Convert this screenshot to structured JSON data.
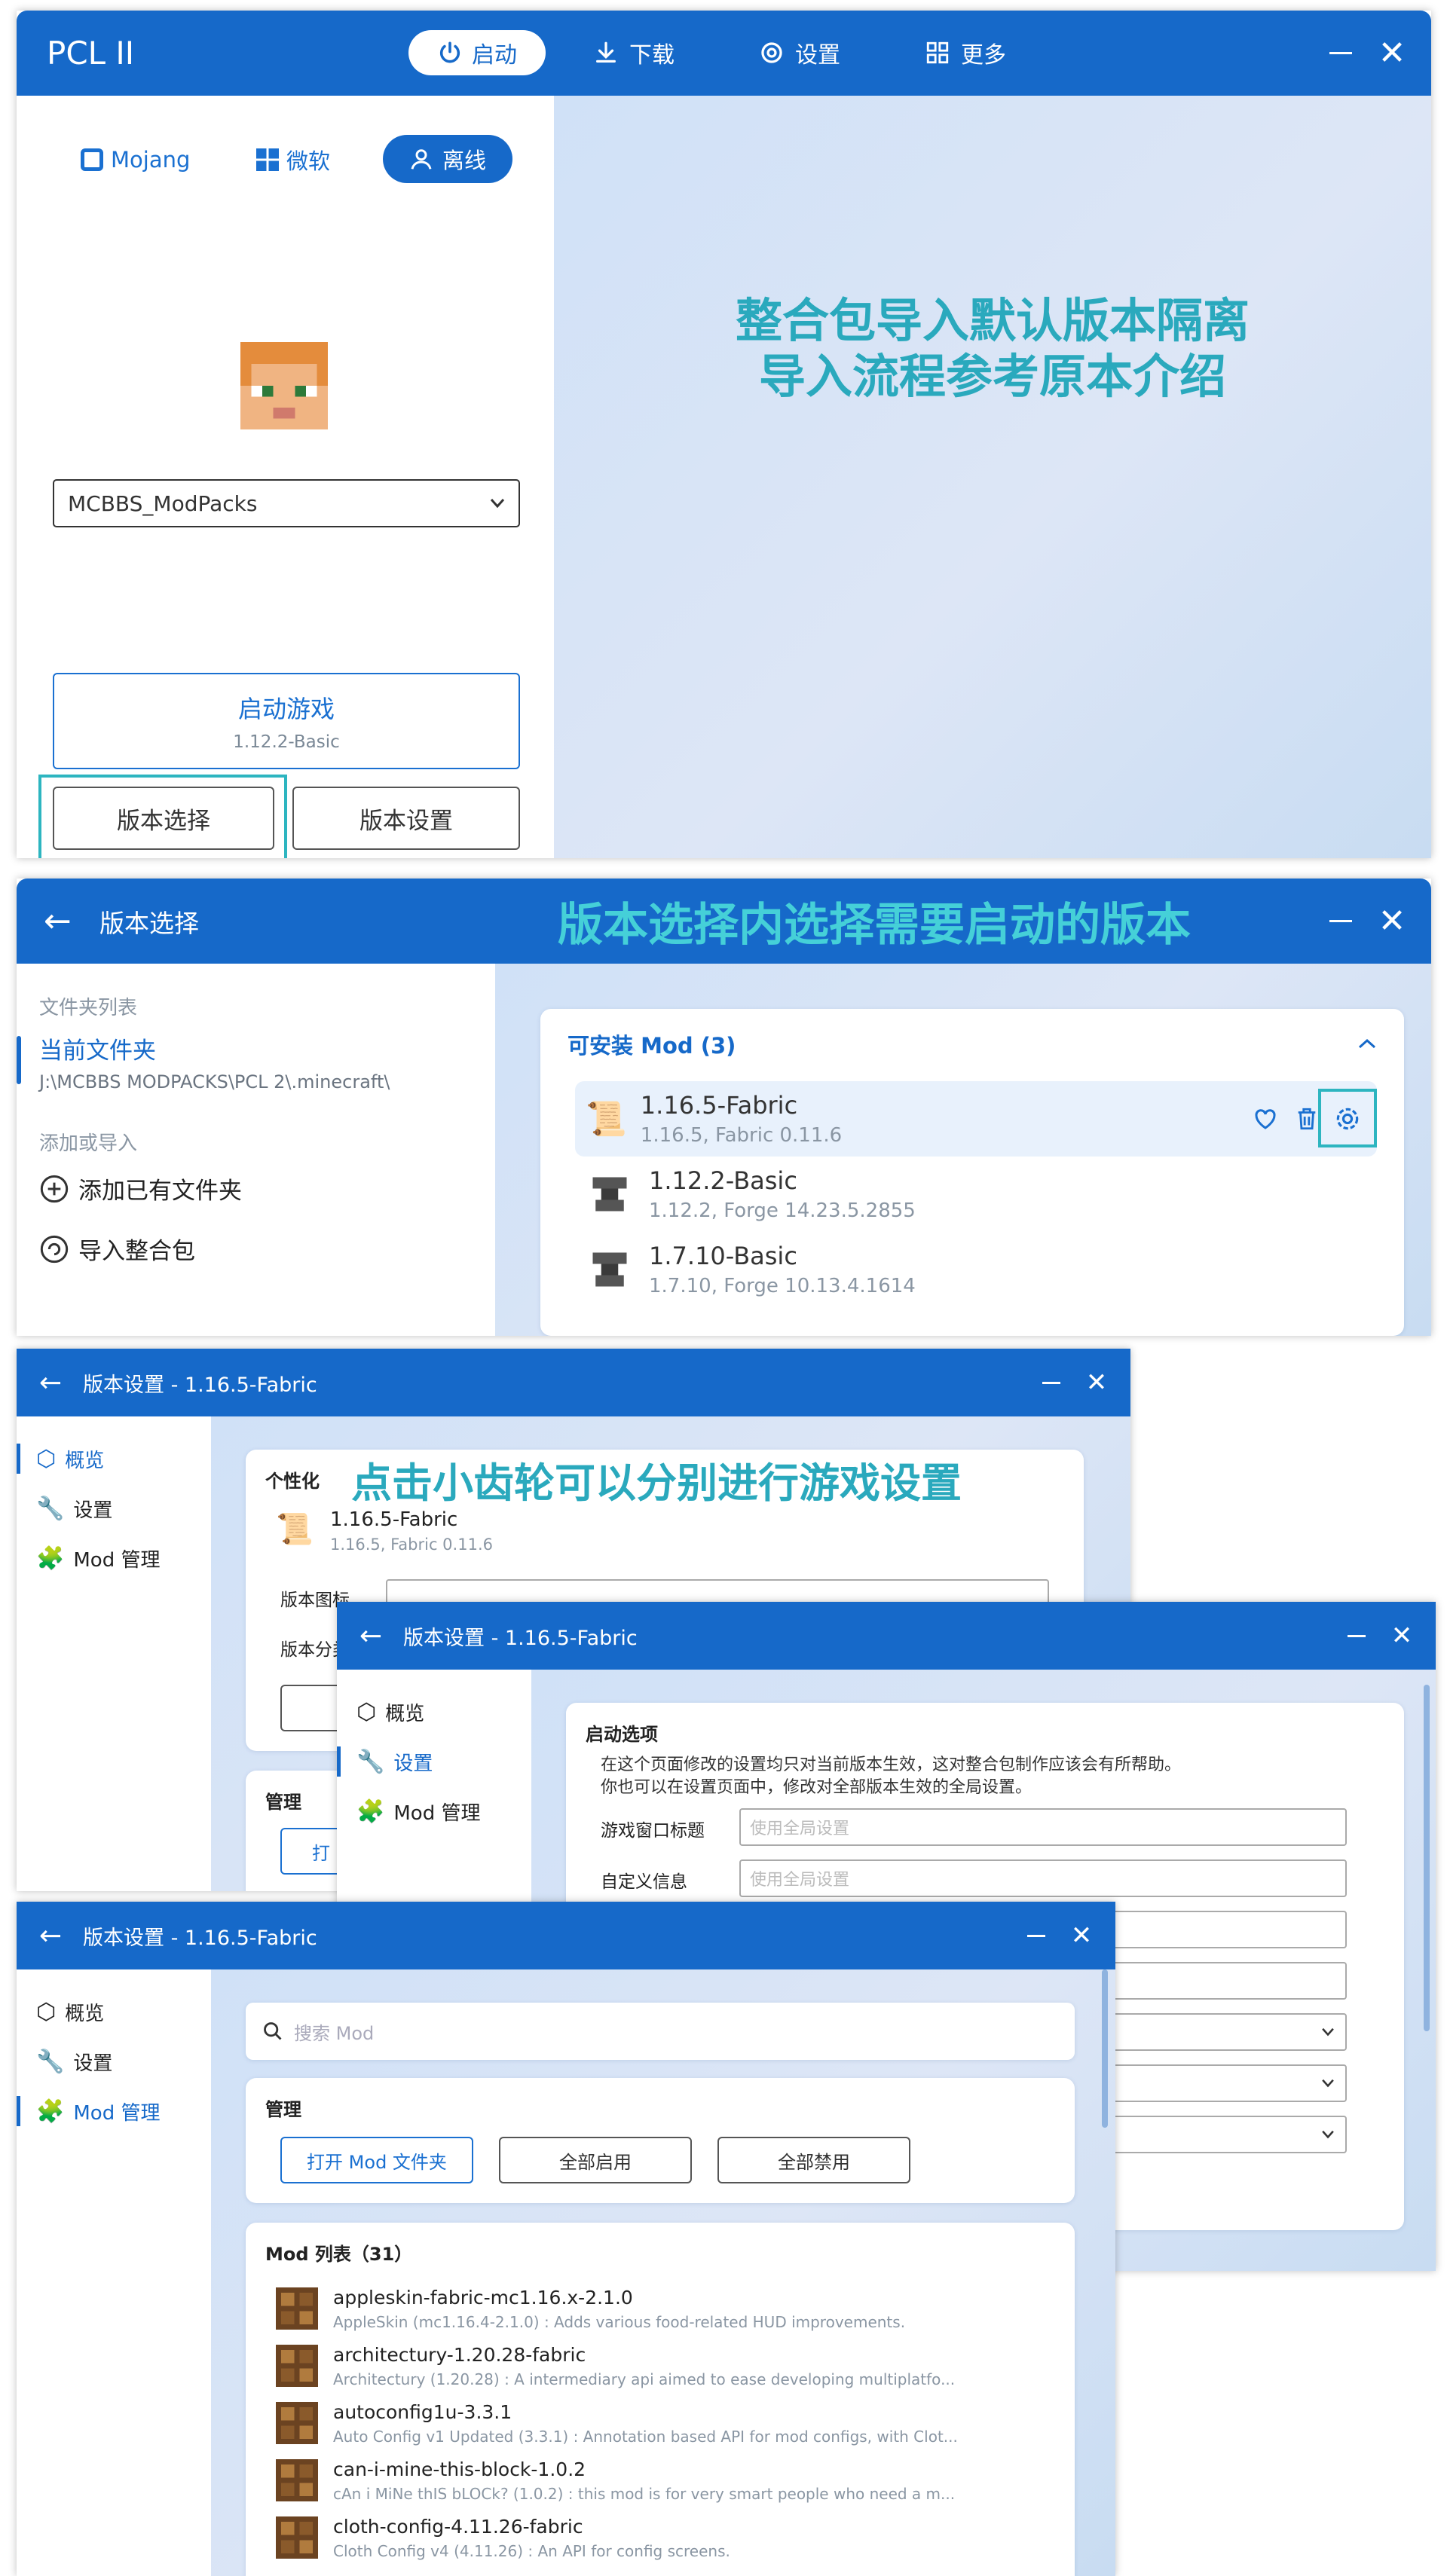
{
  "launcher": {
    "app_title": "PCL II",
    "nav": {
      "launch": "启动",
      "download": "下载",
      "settings": "设置",
      "more": "更多"
    },
    "login_tabs": {
      "mojang": "Mojang",
      "microsoft": "微软",
      "offline": "离线"
    },
    "profile_select": "MCBBS_ModPacks",
    "launch_button": {
      "label": "启动游戏",
      "version": "1.12.2-Basic"
    },
    "version_select": "版本选择",
    "version_settings": "版本设置",
    "annotation_line1": "整合包导入默认版本隔离",
    "annotation_line2": "导入流程参考原本介绍"
  },
  "version_select_window": {
    "title": "版本选择",
    "annotation": "版本选择内选择需要启动的版本",
    "sidebar": {
      "folder_list_header": "文件夹列表",
      "current_folder": "当前文件夹",
      "current_folder_path": "J:\\MCBBS MODPACKS\\PCL 2\\.minecraft\\",
      "add_import_header": "添加或导入",
      "add_existing_folder": "添加已有文件夹",
      "import_modpack": "导入整合包"
    },
    "card": {
      "header": "可安装 Mod (3)",
      "versions": [
        {
          "name": "1.16.5-Fabric",
          "detail": "1.16.5, Fabric 0.11.6",
          "icon": "fabric-scroll-icon"
        },
        {
          "name": "1.12.2-Basic",
          "detail": "1.12.2, Forge 14.23.5.2855",
          "icon": "anvil-icon"
        },
        {
          "name": "1.7.10-Basic",
          "detail": "1.7.10, Forge 10.13.4.1614",
          "icon": "anvil-icon"
        }
      ]
    }
  },
  "version_settings_overview": {
    "title": "版本设置 - 1.16.5-Fabric",
    "annotation": "点击小齿轮可以分别进行游戏设置",
    "nav": [
      "概览",
      "设置",
      "Mod 管理"
    ],
    "personalize_header": "个性化",
    "version_name": "1.16.5-Fabric",
    "version_detail": "1.16.5, Fabric 0.11.6",
    "row1_label": "版本图标",
    "row2_label": "版本分类",
    "manage_header": "管理",
    "manage_btn_partial": "打"
  },
  "version_settings_launch": {
    "title": "版本设置 - 1.16.5-Fabric",
    "nav": [
      "概览",
      "设置",
      "Mod 管理"
    ],
    "section_header": "启动选项",
    "description_line1": "在这个页面修改的设置均只对当前版本生效，这对整合包制作应该会有所帮助。",
    "description_line2": "你也可以在设置页面中，修改对全部版本生效的全局设置。",
    "rows": [
      {
        "label": "游戏窗口标题",
        "placeholder": "使用全局设置"
      },
      {
        "label": "自定义信息",
        "placeholder": "使用全局设置"
      }
    ]
  },
  "version_settings_mods": {
    "title": "版本设置 - 1.16.5-Fabric",
    "nav": [
      "概览",
      "设置",
      "Mod 管理"
    ],
    "search_placeholder": "搜索 Mod",
    "manage_header": "管理",
    "open_mod_folder": "打开 Mod 文件夹",
    "enable_all": "全部启用",
    "disable_all": "全部禁用",
    "mod_list_header": "Mod 列表（31）",
    "mods": [
      {
        "name": "appleskin-fabric-mc1.16.x-2.1.0",
        "desc": "AppleSkin (mc1.16.4-2.1.0) : Adds various food-related HUD improvements."
      },
      {
        "name": "architectury-1.20.28-fabric",
        "desc": "Architectury (1.20.28) : A intermediary api aimed to ease developing multiplatfo..."
      },
      {
        "name": "autoconfig1u-3.3.1",
        "desc": "Auto Config v1 Updated (3.3.1) : Annotation based API for mod configs, with Clot..."
      },
      {
        "name": "can-i-mine-this-block-1.0.2",
        "desc": "cAn i MiNe thIS bLOCk? (1.0.2) : this mod is for very smart people who need a m..."
      },
      {
        "name": "cloth-config-4.11.26-fabric",
        "desc": "Cloth Config v4 (4.11.26) : An API for config screens."
      }
    ]
  },
  "colors": {
    "titlebar": "#1669c9",
    "accent": "#1a70d1",
    "annotation": "#2aa9bd",
    "highlight": "#2db5c0"
  }
}
